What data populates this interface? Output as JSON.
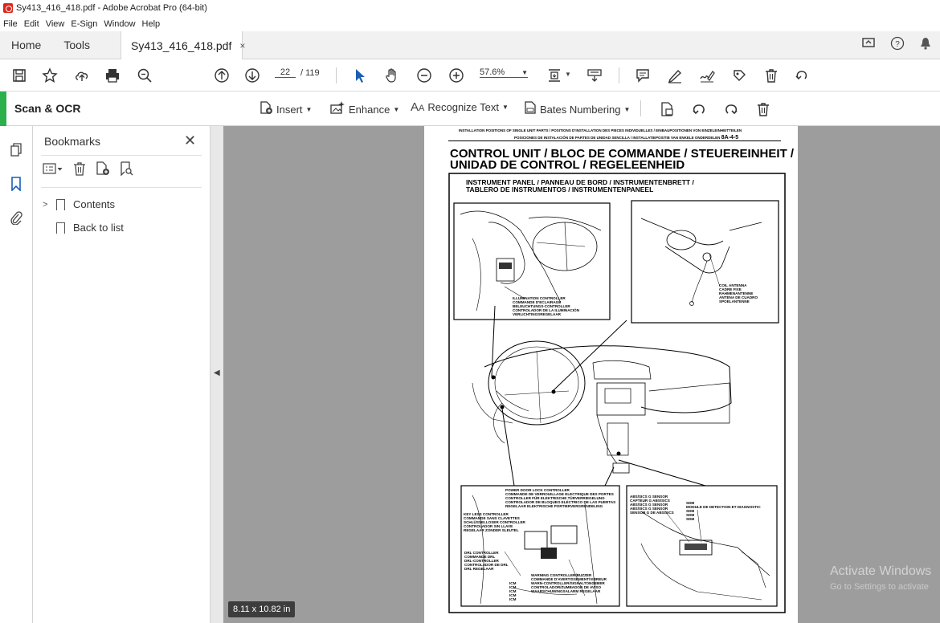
{
  "window": {
    "title": "Sy413_416_418.pdf - Adobe Acrobat Pro (64-bit)"
  },
  "menu": [
    "File",
    "Edit",
    "View",
    "E-Sign",
    "Window",
    "Help"
  ],
  "tabs": {
    "home": "Home",
    "tools": "Tools",
    "doc": "Sy413_416_418.pdf",
    "close": "×"
  },
  "toolbar": {
    "page_current": "22",
    "page_total": "/ 119",
    "zoom": "57.6%"
  },
  "scan": {
    "title": "Scan & OCR",
    "insert": "Insert",
    "enhance": "Enhance",
    "recognize": "Recognize Text",
    "bates": "Bates Numbering"
  },
  "bookmarks": {
    "title": "Bookmarks",
    "items": [
      {
        "label": "Contents"
      },
      {
        "label": "Back to list"
      }
    ]
  },
  "page_size": "8.11 x 10.82 in",
  "watermark": {
    "line1": "Activate Windows",
    "line2": "Go to Settings to activate"
  },
  "document": {
    "header_line1": "INSTALLATION POSITIONS OF SINGLE UNIT PARTS / POSITIONS D'INSTALLATION DES PIECES INDIVIDUELLES / EINBAUPOSITIONEN VON EINZELEINHEITTEILEN",
    "header_line2": "POSICIONES DE INSTALACIÓN DE PARTES DE UNIDAD SENCILLA / INSTALLATIEPOSITIE VAN ENKELE ONDERDELEN",
    "header_code": "8A-4-5",
    "title_line1": "CONTROL UNIT / BLOC DE COMMANDE / STEUEREINHEIT /",
    "title_line2": "UNIDAD DE CONTROL / REGELEENHEID",
    "subtitle_line1": "INSTRUMENT PANEL / PANNEAU DE BORD / INSTRUMENTENBRETT /",
    "subtitle_line2": "TABLERO DE INSTRUMENTOS / INSTRUMENTENPANEEL",
    "illum": [
      "ILLUMINATION CONTROLLER",
      "COMMANDE D'ECLAIRAGE",
      "BELEUCHTUNGS-CONTROLLER",
      "CONTROLADOR DE LA ILUMINACIÓN",
      "VERLICHTINGSREGELAAR"
    ],
    "coil": [
      "COIL ANTENNA",
      "CADRE FIXE",
      "RAHMENANTENNE",
      "ANTENA DE CUADRO",
      "SPOELANTENNE"
    ],
    "power": [
      "POWER DOOR LOCK CONTROLLER",
      "COMMANDE DE VERROUILLAGE ELECTRIQUE DES PORTES",
      "CONTROLLER FÜR ELEKTRISCHE TÜRVERRIEGELUNG",
      "CONTROLADOR DE BLOQUEO ELÉCTRICO DE LAS PUERTAS",
      "REGELAAR ELEKTRISCHE PORTIERVERGRENDELING"
    ],
    "keyless": [
      "KEY LESS CONTROLLER",
      "COMMANDE SANS CLAVETTES",
      "SCHLÜSSELLOSER CONTROLLER",
      "CONTROLADOR SIN LLAVE",
      "REGELAAR ZONDER SLEUTEL"
    ],
    "drl": [
      "DRL CONTROLLER",
      "COMMANDE DRL",
      "DRL-CONTROLLER",
      "CONTROLADOR DE DRL",
      "DRL REGELAAR"
    ],
    "warning": [
      "WARNING CONTROLLER/BUZZER",
      "COMMANDE D'AVERTISSEMENT/VIBREUR",
      "WARN-CONTROLLER/SIGNALTONGEBER",
      "CONTROLADOR/ZUMBADOR DE AVISO",
      "WAARSCHUWINGSALARM REGELAAR"
    ],
    "icm": [
      "ICM",
      "ICM",
      "ICM",
      "ICM",
      "ICM"
    ],
    "abs": [
      "ABS/SICS G SENSOR",
      "CAPTEUR G ABS/SICS",
      "ABS/SICS G SENSOR",
      "ABS/SICS G SENSOR",
      "SENSOR G DE ABS/SICS"
    ],
    "sdm": [
      "SDM",
      "MODULE DE DETECTION ET DIAGNOSTIC",
      "SDM",
      "SDM",
      "SDM"
    ]
  }
}
